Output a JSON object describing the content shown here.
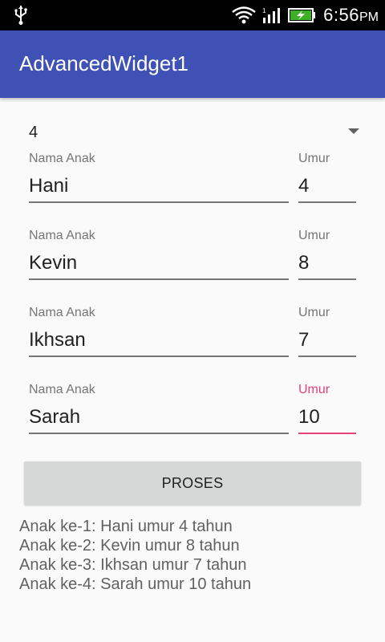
{
  "status_bar": {
    "time": "6:56",
    "ampm": "PM",
    "icons": [
      "usb-icon",
      "wifi-icon",
      "signal-icon",
      "battery-charging-icon"
    ]
  },
  "app_bar": {
    "title": "AdvancedWidget1",
    "color": "#3f51b5"
  },
  "spinner": {
    "selected": "4"
  },
  "children": [
    {
      "name_label": "Nama Anak",
      "name": "Hani",
      "age_label": "Umur",
      "age": "4"
    },
    {
      "name_label": "Nama Anak",
      "name": "Kevin",
      "age_label": "Umur",
      "age": "8"
    },
    {
      "name_label": "Nama Anak",
      "name": "Ikhsan",
      "age_label": "Umur",
      "age": "7"
    },
    {
      "name_label": "Nama Anak",
      "name": "Sarah",
      "age_label": "Umur",
      "age": "10"
    }
  ],
  "focus_color": "#e83f78",
  "button": {
    "label": "PROSES"
  },
  "results": [
    "Anak ke-1: Hani umur 4 tahun",
    "Anak ke-2: Kevin umur 8 tahun",
    "Anak ke-3: Ikhsan umur 7 tahun",
    "Anak ke-4: Sarah umur 10 tahun"
  ]
}
